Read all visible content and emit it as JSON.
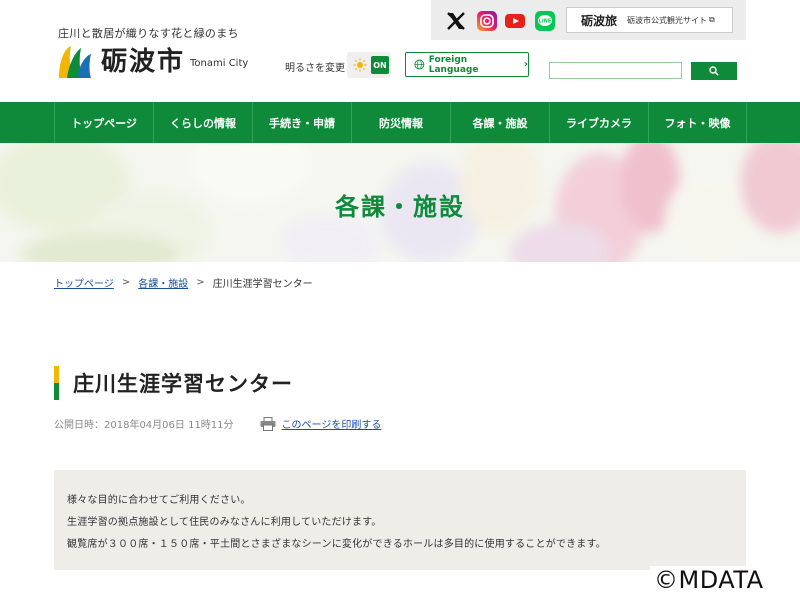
{
  "header": {
    "tagline": "庄川と散居が織りなす花と緑のまち",
    "logo_name": "砺波市",
    "logo_roman": "Tonami City",
    "brightness_label": "明るさを変更",
    "brightness_state": "ON",
    "foreign_language": "Foreign Language",
    "tourism_logo": "砺波旅",
    "tourism_label": "砺波市公式観光サイト",
    "search_placeholder": ""
  },
  "sns": {
    "icons": [
      "x-icon",
      "instagram-icon",
      "youtube-icon",
      "line-icon"
    ]
  },
  "nav": {
    "items": [
      {
        "label": "トップページ"
      },
      {
        "label": "くらしの情報"
      },
      {
        "label": "手続き・申請"
      },
      {
        "label": "防災情報"
      },
      {
        "label": "各課・施設"
      },
      {
        "label": "ライブカメラ"
      },
      {
        "label": "フォト・映像"
      }
    ]
  },
  "hero": {
    "title": "各課・施設"
  },
  "breadcrumb": {
    "items": [
      {
        "label": "トップページ"
      },
      {
        "label": "各課・施設"
      }
    ],
    "current": "庄川生涯学習センター",
    "separator": ">"
  },
  "page": {
    "title": "庄川生涯学習センター",
    "published": "公開日時：2018年04月06日 11時11分",
    "print_label": "このページを印刷する"
  },
  "content": {
    "paragraphs": [
      "様々な目的に合わせてご利用ください。",
      "生涯学習の拠点施設として住民のみなさんに利用していただけます。",
      "観覧席が３００席・１５０席・平土間とさまざまなシーンに変化ができるホールは多目的に使用することができます。"
    ]
  },
  "watermark": "©MDATA",
  "colors": {
    "brand_green": "#0e8a3a",
    "accent_yellow": "#f2b705",
    "link_blue": "#1a4fa0",
    "content_bg": "#eeede8"
  }
}
